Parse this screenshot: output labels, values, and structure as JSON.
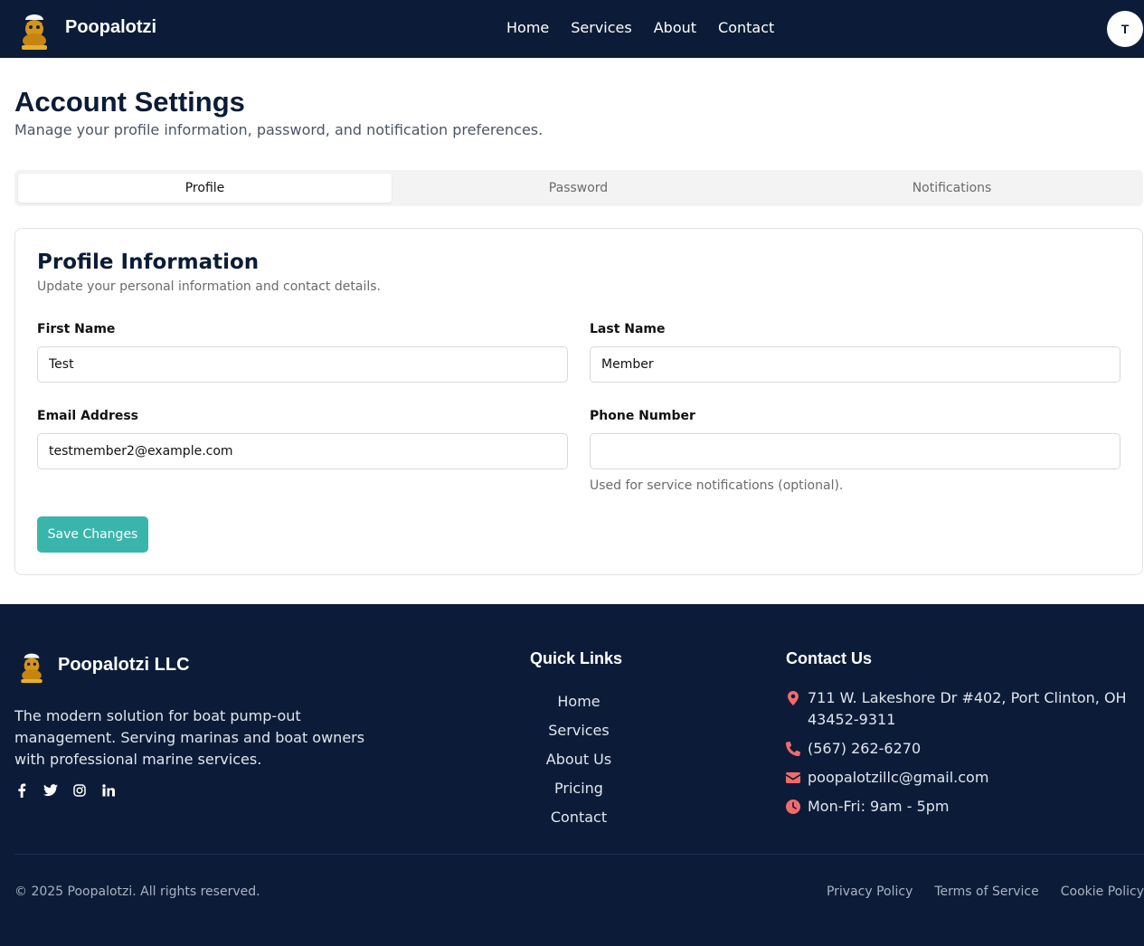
{
  "header": {
    "brand": "Poopalotzi",
    "nav": [
      "Home",
      "Services",
      "About",
      "Contact"
    ],
    "avatar_initial": "T"
  },
  "page": {
    "title": "Account Settings",
    "subtitle": "Manage your profile information, password, and notification preferences."
  },
  "tabs": [
    {
      "label": "Profile",
      "active": true
    },
    {
      "label": "Password",
      "active": false
    },
    {
      "label": "Notifications",
      "active": false
    }
  ],
  "profile": {
    "title": "Profile Information",
    "subtitle": "Update your personal information and contact details.",
    "first_name_label": "First Name",
    "first_name_value": "Test",
    "last_name_label": "Last Name",
    "last_name_value": "Member",
    "email_label": "Email Address",
    "email_value": "testmember2@example.com",
    "phone_label": "Phone Number",
    "phone_value": "",
    "phone_hint": "Used for service notifications (optional).",
    "save_label": "Save Changes"
  },
  "footer": {
    "brand": "Poopalotzi LLC",
    "description": "The modern solution for boat pump-out management. Serving marinas and boat owners with professional marine services.",
    "socials": [
      "facebook-icon",
      "twitter-icon",
      "instagram-icon",
      "linkedin-icon"
    ],
    "quick_links_title": "Quick Links",
    "quick_links": [
      "Home",
      "Services",
      "About Us",
      "Pricing",
      "Contact"
    ],
    "contact_title": "Contact Us",
    "address_line1": "711 W. Lakeshore Dr #402, Port Clinton, OH",
    "address_line2": "43452-9311",
    "phone": "(567) 262-6270",
    "email": "poopalotzillc@gmail.com",
    "hours": "Mon-Fri: 9am - 5pm",
    "copyright": "© 2025 Poopalotzi. All rights reserved.",
    "legal": [
      "Privacy Policy",
      "Terms of Service",
      "Cookie Policy"
    ]
  },
  "colors": {
    "navy": "#0c1c38",
    "accent": "#3ab5ac",
    "icon_red": "#f26b6b"
  }
}
